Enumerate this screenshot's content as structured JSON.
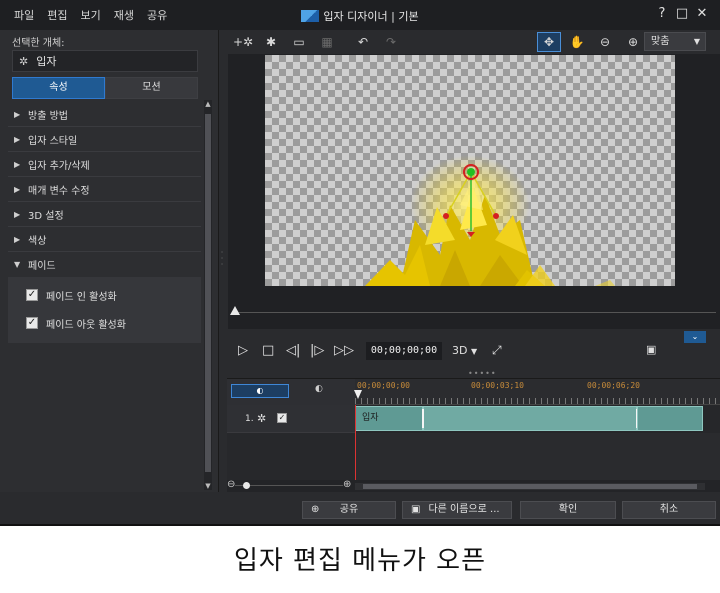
{
  "menu": [
    "파일",
    "편집",
    "보기",
    "재생",
    "공유"
  ],
  "window_title": "입자 디자이너 | 기본",
  "window_buttons": [
    "?",
    "□",
    "✕"
  ],
  "left_panel": {
    "selected_label": "선택한 개체:",
    "selected_object": "입자",
    "tabs": [
      "속성",
      "모션"
    ],
    "active_tab": "속성",
    "items": [
      "방출 방법",
      "입자 스타일",
      "입자 추가/삭제",
      "매개 변수 수정",
      "3D 설정",
      "색상"
    ],
    "open_item": "페이드",
    "fade_options": [
      {
        "label": "페이드 인 활성화",
        "checked": true
      },
      {
        "label": "페이드 아웃 활성화",
        "checked": true
      }
    ]
  },
  "preview_toolbar": {
    "icons": [
      "add-particle-icon",
      "particle-settings-icon",
      "safe-zone-icon",
      "grid-icon",
      "undo-icon",
      "redo-icon",
      "move-icon",
      "hand-icon",
      "zoom-out-icon",
      "zoom-in-icon"
    ],
    "zoom_select": "맞춤"
  },
  "playback": {
    "timecode": "00;00;00;00",
    "mode": "3D"
  },
  "timeline": {
    "ruler_labels": [
      "00;00;00;00",
      "00;00;03;10",
      "00;00;06;20"
    ],
    "track_number": "1.",
    "track_checked": true,
    "clip_label": "입자"
  },
  "bottom_buttons": {
    "share": "공유",
    "save_as": "다른 이름으로 ...",
    "ok": "확인",
    "cancel": "취소"
  },
  "colors": {
    "accent": "#1f5a93",
    "clip": "#70aaa3",
    "timecode_ruler": "#c88c3a"
  },
  "caption": "입자 편집 메뉴가 오픈"
}
